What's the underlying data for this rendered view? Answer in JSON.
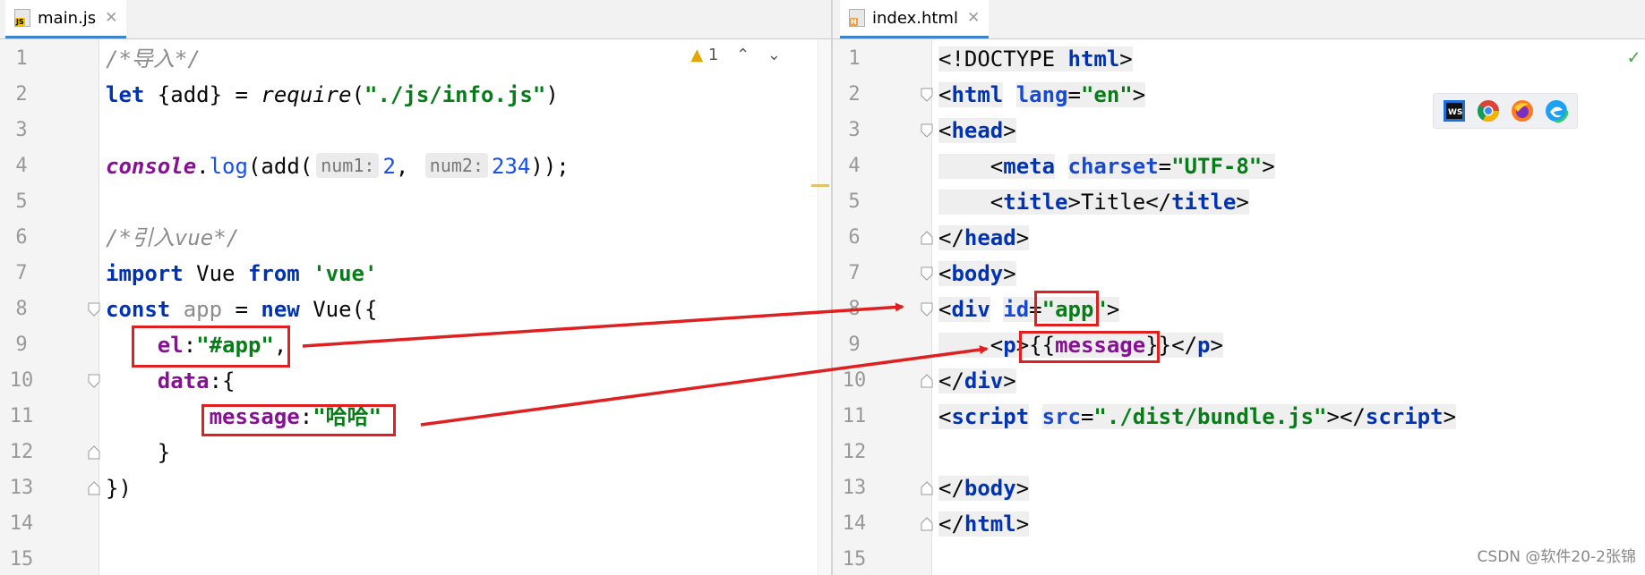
{
  "left": {
    "tab": {
      "filename": "main.js",
      "icon_label": "JS",
      "close": "✕"
    },
    "inspection": {
      "warning_count": "1",
      "up": "⌃",
      "down": "⌄"
    },
    "lines": [
      {
        "n": "1",
        "segments": [
          {
            "c": "com",
            "t": "/*导入*/"
          }
        ]
      },
      {
        "n": "2",
        "segments": [
          {
            "c": "kw",
            "t": "let"
          },
          {
            "c": "",
            "t": " {add} = "
          },
          {
            "c": "it",
            "t": "require"
          },
          {
            "c": "",
            "t": "("
          },
          {
            "c": "str",
            "t": "\"./js/info.js\""
          },
          {
            "c": "",
            "t": ")"
          }
        ]
      },
      {
        "n": "3",
        "segments": []
      },
      {
        "n": "4",
        "segments": [
          {
            "c": "it prop",
            "t": "console"
          },
          {
            "c": "",
            "t": "."
          },
          {
            "c": "num",
            "t": "log"
          },
          {
            "c": "",
            "t": "(add("
          },
          {
            "c": "hint",
            "t": "num1:"
          },
          {
            "c": "num",
            "t": "2"
          },
          {
            "c": "",
            "t": ", "
          },
          {
            "c": "hint",
            "t": "num2:"
          },
          {
            "c": "num",
            "t": "234"
          },
          {
            "c": "",
            "t": "));"
          }
        ]
      },
      {
        "n": "5",
        "segments": []
      },
      {
        "n": "6",
        "segments": [
          {
            "c": "com",
            "t": "/*引入vue*/"
          }
        ]
      },
      {
        "n": "7",
        "segments": [
          {
            "c": "kw",
            "t": "import"
          },
          {
            "c": "",
            "t": " Vue "
          },
          {
            "c": "kw",
            "t": "from"
          },
          {
            "c": "",
            "t": " "
          },
          {
            "c": "str",
            "t": "'vue'"
          }
        ]
      },
      {
        "n": "8",
        "segments": [
          {
            "c": "kw",
            "t": "const"
          },
          {
            "c": "",
            "t": " "
          },
          {
            "c": "gray",
            "t": "app"
          },
          {
            "c": "",
            "t": " = "
          },
          {
            "c": "kw",
            "t": "new"
          },
          {
            "c": "",
            "t": " Vue({"
          }
        ]
      },
      {
        "n": "9",
        "segments": [
          {
            "c": "",
            "t": "    "
          },
          {
            "c": "prop",
            "t": "el"
          },
          {
            "c": "",
            "t": ":"
          },
          {
            "c": "str",
            "t": "\"#app\""
          },
          {
            "c": "",
            "t": ","
          }
        ]
      },
      {
        "n": "10",
        "segments": [
          {
            "c": "",
            "t": "    "
          },
          {
            "c": "prop",
            "t": "data"
          },
          {
            "c": "",
            "t": ":{"
          }
        ]
      },
      {
        "n": "11",
        "segments": [
          {
            "c": "",
            "t": "        "
          },
          {
            "c": "prop",
            "t": "message"
          },
          {
            "c": "",
            "t": ":"
          },
          {
            "c": "str",
            "t": "\"哈哈\""
          }
        ]
      },
      {
        "n": "12",
        "segments": [
          {
            "c": "",
            "t": "    }"
          }
        ]
      },
      {
        "n": "13",
        "segments": [
          {
            "c": "",
            "t": "})"
          }
        ]
      },
      {
        "n": "14",
        "segments": []
      },
      {
        "n": "15",
        "segments": []
      }
    ]
  },
  "right": {
    "tab": {
      "filename": "index.html",
      "icon_label": "H",
      "close": "✕"
    },
    "check": "✓",
    "browsers": [
      "ws-icon",
      "chrome-icon",
      "firefox-icon",
      "edge-icon"
    ],
    "lines": [
      {
        "n": "1",
        "segments": [
          {
            "c": "",
            "t": "<!DOCTYPE "
          },
          {
            "c": "tag",
            "t": "html"
          },
          {
            "c": "",
            "t": ">"
          }
        ]
      },
      {
        "n": "2",
        "segments": [
          {
            "c": "",
            "t": "<"
          },
          {
            "c": "tag",
            "t": "html"
          },
          {
            "c": "",
            "t": " "
          },
          {
            "c": "attr",
            "t": "lang"
          },
          {
            "c": "",
            "t": "="
          },
          {
            "c": "aval",
            "t": "\"en\""
          },
          {
            "c": "",
            "t": ">"
          }
        ]
      },
      {
        "n": "3",
        "segments": [
          {
            "c": "",
            "t": "<"
          },
          {
            "c": "tag",
            "t": "head"
          },
          {
            "c": "",
            "t": ">"
          }
        ]
      },
      {
        "n": "4",
        "segments": [
          {
            "c": "",
            "t": "    <"
          },
          {
            "c": "tag",
            "t": "meta"
          },
          {
            "c": "",
            "t": " "
          },
          {
            "c": "attr",
            "t": "charset"
          },
          {
            "c": "",
            "t": "="
          },
          {
            "c": "aval",
            "t": "\"UTF-8\""
          },
          {
            "c": "",
            "t": ">"
          }
        ]
      },
      {
        "n": "5",
        "segments": [
          {
            "c": "",
            "t": "    <"
          },
          {
            "c": "tag",
            "t": "title"
          },
          {
            "c": "",
            "t": ">Title</"
          },
          {
            "c": "tag",
            "t": "title"
          },
          {
            "c": "",
            "t": ">"
          }
        ]
      },
      {
        "n": "6",
        "segments": [
          {
            "c": "",
            "t": "</"
          },
          {
            "c": "tag",
            "t": "head"
          },
          {
            "c": "",
            "t": ">"
          }
        ]
      },
      {
        "n": "7",
        "segments": [
          {
            "c": "",
            "t": "<"
          },
          {
            "c": "tag",
            "t": "body"
          },
          {
            "c": "",
            "t": ">"
          }
        ]
      },
      {
        "n": "8",
        "segments": [
          {
            "c": "",
            "t": "<"
          },
          {
            "c": "tag",
            "t": "div"
          },
          {
            "c": "",
            "t": " "
          },
          {
            "c": "attr",
            "t": "id"
          },
          {
            "c": "",
            "t": "="
          },
          {
            "c": "aval",
            "t": "\"app\""
          },
          {
            "c": "",
            "t": ">"
          }
        ]
      },
      {
        "n": "9",
        "segments": [
          {
            "c": "",
            "t": "    <"
          },
          {
            "c": "tag",
            "t": "p"
          },
          {
            "c": "",
            "t": ">{{"
          },
          {
            "c": "prop",
            "t": "message"
          },
          {
            "c": "",
            "t": "}}</"
          },
          {
            "c": "tag",
            "t": "p"
          },
          {
            "c": "",
            "t": ">"
          }
        ]
      },
      {
        "n": "10",
        "segments": [
          {
            "c": "",
            "t": "</"
          },
          {
            "c": "tag",
            "t": "div"
          },
          {
            "c": "",
            "t": ">"
          }
        ]
      },
      {
        "n": "11",
        "segments": [
          {
            "c": "",
            "t": "<"
          },
          {
            "c": "tag",
            "t": "script"
          },
          {
            "c": "",
            "t": " "
          },
          {
            "c": "attr",
            "t": "src"
          },
          {
            "c": "",
            "t": "="
          },
          {
            "c": "aval",
            "t": "\"./dist/bundle.js\""
          },
          {
            "c": "",
            "t": "></"
          },
          {
            "c": "tag",
            "t": "script"
          },
          {
            "c": "",
            "t": ">"
          }
        ]
      },
      {
        "n": "12",
        "segments": []
      },
      {
        "n": "13",
        "segments": [
          {
            "c": "",
            "t": "</"
          },
          {
            "c": "tag",
            "t": "body"
          },
          {
            "c": "",
            "t": ">"
          }
        ]
      },
      {
        "n": "14",
        "segments": [
          {
            "c": "",
            "t": "</"
          },
          {
            "c": "tag",
            "t": "html"
          },
          {
            "c": "",
            "t": ">"
          }
        ]
      },
      {
        "n": "15",
        "segments": []
      }
    ]
  },
  "watermark": "CSDN @软件20-2张锦",
  "colors": {
    "annotation": "#e02020",
    "tab_underline": "#4083c9"
  }
}
